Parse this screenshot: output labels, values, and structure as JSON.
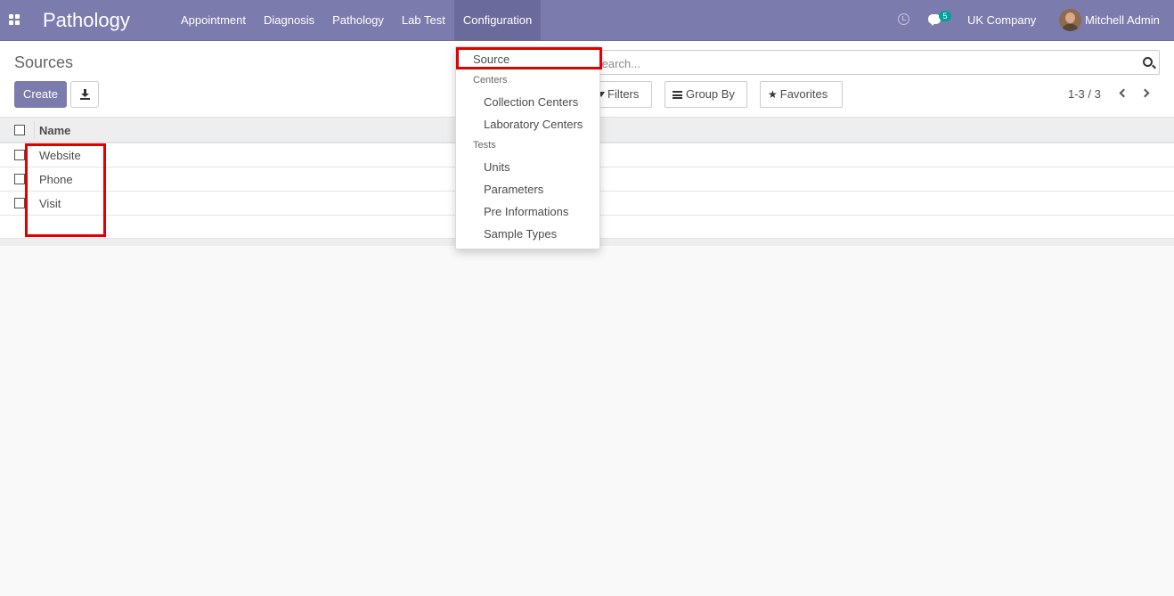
{
  "navbar": {
    "app_title": "Pathology",
    "menu": [
      {
        "label": "Appointment"
      },
      {
        "label": "Diagnosis"
      },
      {
        "label": "Pathology"
      },
      {
        "label": "Lab Test"
      },
      {
        "label": "Configuration"
      }
    ],
    "message_count": "5",
    "company": "UK Company",
    "user": "Mitchell Admin",
    "accent_color": "#7c7bad"
  },
  "control_panel": {
    "breadcrumb": "Sources",
    "create_label": "Create",
    "search_placeholder": "Search...",
    "filters_label": "Filters",
    "groupby_label": "Group By",
    "favorites_label": "Favorites",
    "pager": "1-3 / 3"
  },
  "list": {
    "column_name": "Name",
    "rows": [
      "Website",
      "Phone",
      "Visit"
    ]
  },
  "dropdown": {
    "source": "Source",
    "centers_header": "Centers",
    "collection_centers": "Collection Centers",
    "laboratory_centers": "Laboratory Centers",
    "tests_header": "Tests",
    "units": "Units",
    "parameters": "Parameters",
    "pre_informations": "Pre Informations",
    "sample_types": "Sample Types"
  },
  "annotations": {
    "highlight_color": "#e10000"
  }
}
